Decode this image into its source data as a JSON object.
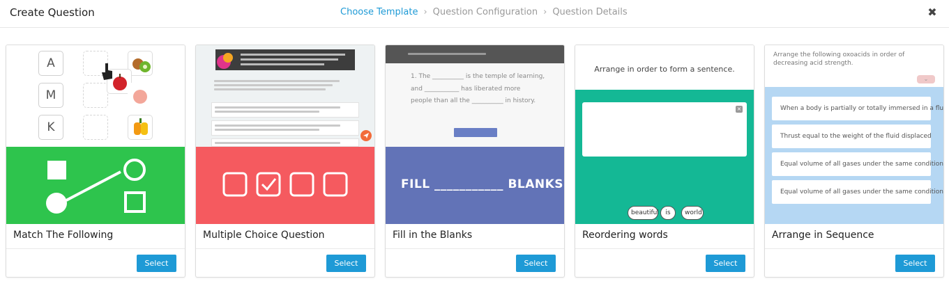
{
  "header": {
    "title": "Create Question",
    "steps": [
      {
        "label": "Choose Template",
        "active": true
      },
      {
        "label": "Question Configuration",
        "active": false
      },
      {
        "label": "Question Details",
        "active": false
      }
    ],
    "step_separator": "›",
    "close_icon": "close-icon",
    "close_glyph": "✖"
  },
  "colors": {
    "accent": "#1e9ad6",
    "match_green": "#2ec44d",
    "mcq_red": "#f55a5f",
    "blanks_blue": "#6273b7",
    "reorder_teal": "#14b895",
    "arrange_blue": "#b5d7f3"
  },
  "cards": [
    {
      "title": "Match The Following",
      "select_label": "Select",
      "preview": {
        "letters": [
          "A",
          "M",
          "K"
        ]
      }
    },
    {
      "title": "Multiple Choice Question",
      "select_label": "Select"
    },
    {
      "title": "Fill in the Blanks",
      "select_label": "Select",
      "preview": {
        "lines": [
          "1. The __________ is the temple of learning,",
          "and ___________ has liberated more",
          "people than all the __________ in history."
        ],
        "banner": "FILL ___________ BLANKS"
      }
    },
    {
      "title": "Reordering words",
      "select_label": "Select",
      "preview": {
        "question": "Arrange in order to form a sentence.",
        "words": [
          "beautiful",
          "is",
          "world"
        ]
      }
    },
    {
      "title": "Arrange in Sequence",
      "select_label": "Select",
      "preview": {
        "question": "Arrange the following oxoacids in order of decreasing acid strength.",
        "items": [
          "When a body is partially or totally immersed in a fluid",
          "Thrust equal to the weight of the fluid displaced",
          "Equal volume of all gases under the same conditions",
          "Equal volume of all gases under the same conditions"
        ]
      }
    }
  ]
}
